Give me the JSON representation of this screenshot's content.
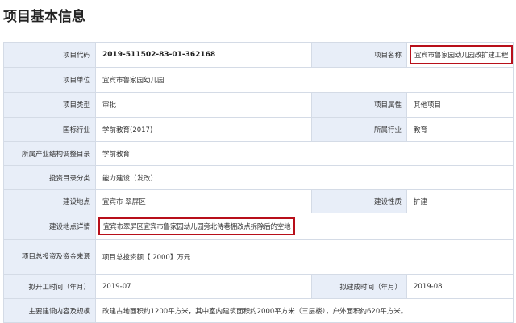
{
  "title": "项目基本信息",
  "rows": [
    {
      "l1": "项目代码",
      "v1": "2019-511502-83-01-362168",
      "l2": "项目名称",
      "v2": "宜宾市鲁家园幼儿园改扩建工程"
    },
    {
      "l1": "项目单位",
      "v1": "宜宾市鲁家园幼儿园"
    },
    {
      "l1": "项目类型",
      "v1": "审批",
      "l2": "项目属性",
      "v2": "其他项目"
    },
    {
      "l1": "国标行业",
      "v1": "学前教育(2017)",
      "l2": "所属行业",
      "v2": "教育"
    },
    {
      "l1": "所属产业结构调整目录",
      "v1": "学前教育"
    },
    {
      "l1": "投资目录分类",
      "v1": "能力建设（发改）"
    },
    {
      "l1": "建设地点",
      "v1": "宜宾市 翠屏区",
      "l2": "建设性质",
      "v2": "扩建"
    },
    {
      "l1": "建设地点详情",
      "v1": "宜宾市翠屏区宜宾市鲁家园幼儿园旁北侍巷棚改点拆除后的空地"
    },
    {
      "l1": "项目总投资及资金来源",
      "v1": "项目总投资额【 2000】万元"
    },
    {
      "l1": "拟开工时间（年月）",
      "v1": "2019-07",
      "l2": "拟建成时间（年月）",
      "v2": "2019-08"
    },
    {
      "l1": "主要建设内容及规模",
      "v1": "改建占地面积约1200平方米，其中室内建筑面积约2000平方米（三层楼），户外面积约620平方米。"
    }
  ]
}
